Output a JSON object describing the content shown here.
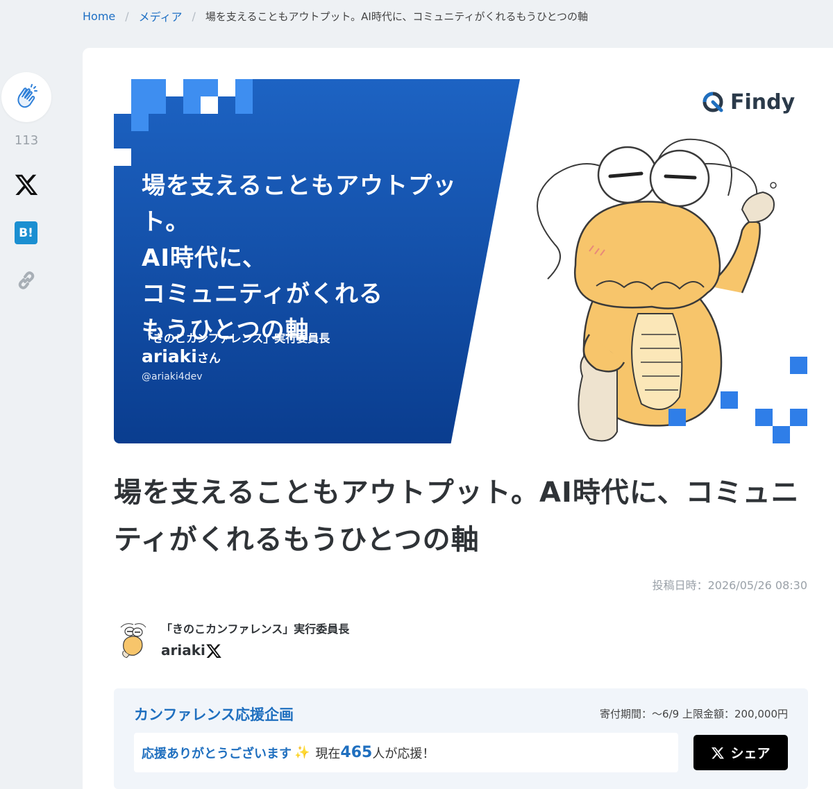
{
  "breadcrumb": {
    "home": "Home",
    "media": "メディア",
    "current": "場を支えることもアウトプット。AI時代に、コミュニティがくれるもうひとつの軸"
  },
  "rail": {
    "clap_count": "113",
    "hatena_label": "B!"
  },
  "hero": {
    "title": "場を支えることもアウトプット。\nAI時代に、\nコミュニティがくれる\nもうひとつの軸",
    "role": "「きのこカンファレンス」実行委員長",
    "name": "ariaki",
    "name_suffix": "さん",
    "handle": "@ariaki4dev",
    "brand": "Findy"
  },
  "article": {
    "title": "場を支えることもアウトプット。AI時代に、コミュニティがくれるもうひとつの軸",
    "posted_at": "投稿日時：2026/05/26 08:30"
  },
  "author": {
    "role": "「きのこカンファレンス」実行委員長",
    "name": "ariaki"
  },
  "support": {
    "title": "カンファレンス応援企画",
    "info": "寄付期間：〜6/9 上限金額：200,000円",
    "thanks": "応援ありがとうございます",
    "pre": "現在",
    "count": "465",
    "post": "人が応援！",
    "share_label": "シェア"
  },
  "colors": {
    "accent": "#1f6fbf",
    "hero_blue": "#1d63c3",
    "background": "#eef1f4"
  }
}
